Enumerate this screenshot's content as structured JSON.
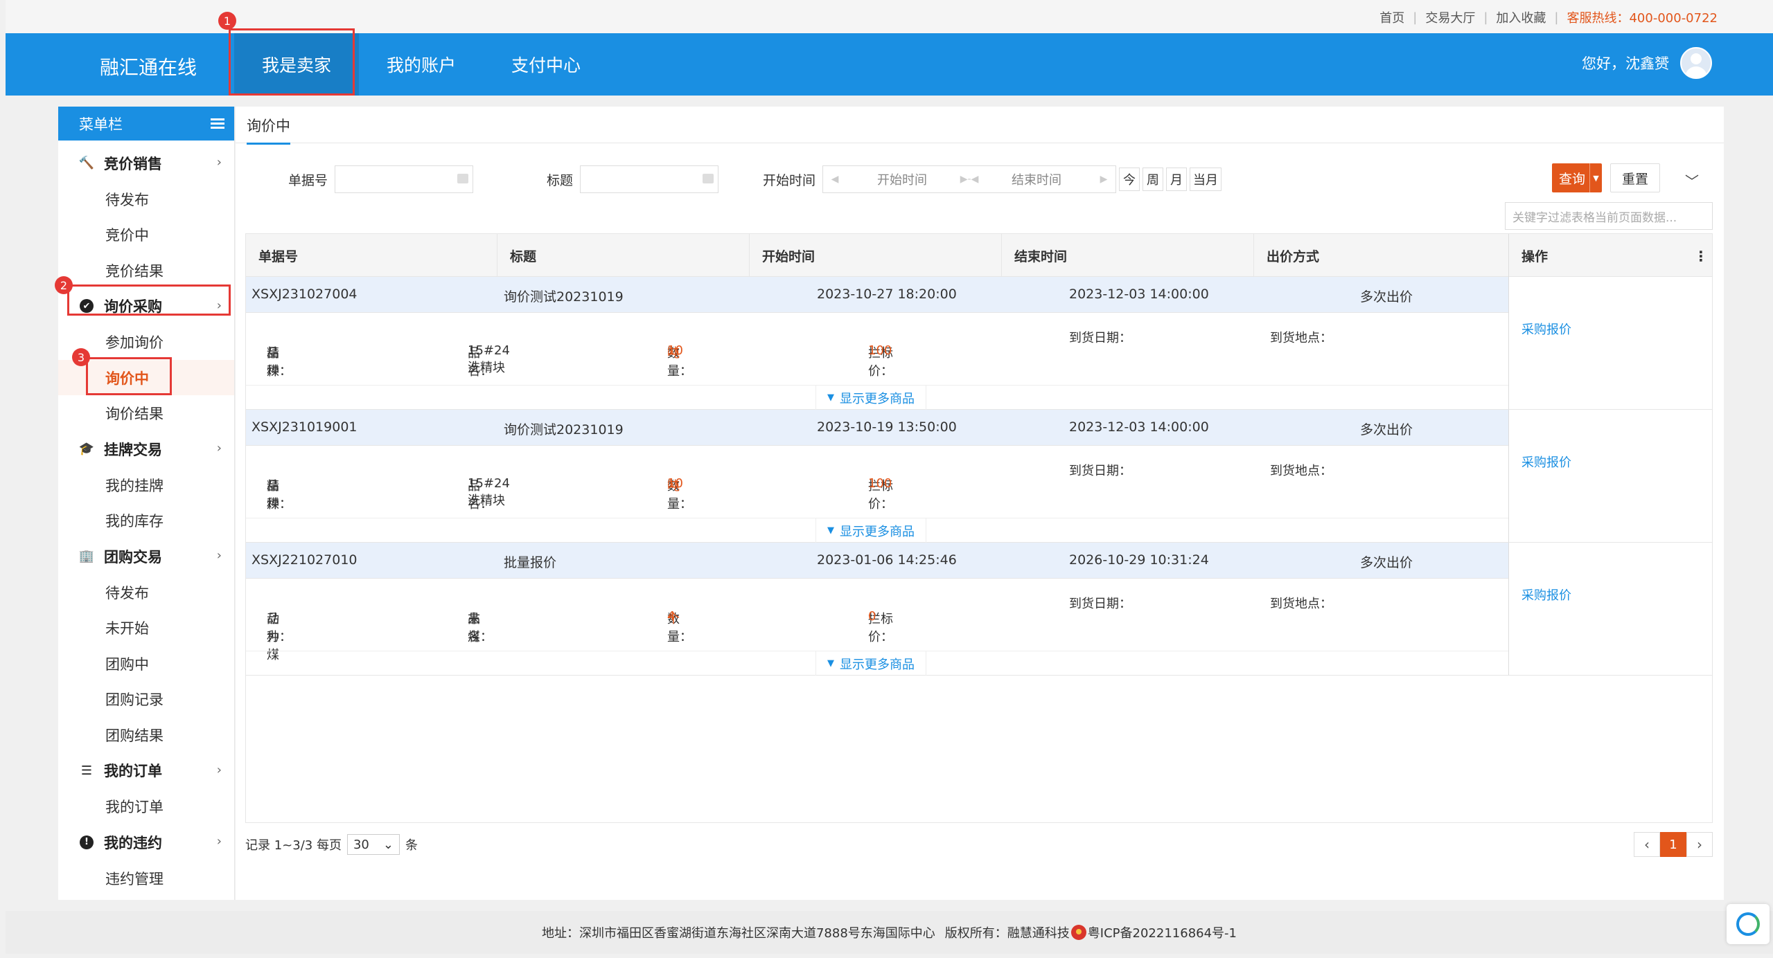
{
  "top_links": {
    "home": "首页",
    "hall": "交易大厅",
    "favorite": "加入收藏",
    "hotline": "客服热线：400-000-0722"
  },
  "header": {
    "brand": "融汇通在线",
    "nav": [
      "我是卖家",
      "我的账户",
      "支付中心"
    ],
    "greeting": "您好，沈鑫赟"
  },
  "sidebar": {
    "title": "菜单栏",
    "groups": [
      {
        "label": "竞价销售",
        "items": [
          "待发布",
          "竞价中",
          "竞价结果"
        ]
      },
      {
        "label": "询价采购",
        "items": [
          "参加询价",
          "询价中",
          "询价结果"
        ]
      },
      {
        "label": "挂牌交易",
        "items": [
          "我的挂牌",
          "我的库存"
        ]
      },
      {
        "label": "团购交易",
        "items": [
          "待发布",
          "未开始",
          "团购中",
          "团购记录",
          "团购结果"
        ]
      },
      {
        "label": "我的订单",
        "items": [
          "我的订单"
        ]
      },
      {
        "label": "我的违约",
        "items": [
          "违约管理"
        ]
      }
    ]
  },
  "tab": {
    "label": "询价中"
  },
  "filters": {
    "doc_no_label": "单据号",
    "title_label": "标题",
    "time_label": "开始时间",
    "start_placeholder": "开始时间",
    "end_placeholder": "结束时间",
    "quick": [
      "今",
      "周",
      "月",
      "当月"
    ],
    "search_label": "查询",
    "reset_label": "重置",
    "keyword_placeholder": "关键字过滤表格当前页面数据..."
  },
  "table": {
    "columns": [
      "单据号",
      "标题",
      "开始时间",
      "结束时间",
      "出价方式"
    ],
    "ops_header": "操作",
    "labels": {
      "variety": "品种：",
      "name": "品名：",
      "qty": "数量：",
      "price": "拦标价：",
      "date": "到货日期：",
      "place": "到货地点："
    },
    "more_label": "显示更多商品",
    "action_label": "采购报价",
    "rows": [
      {
        "no": "XSXJ231027004",
        "title": "询价测试20231019",
        "start": "2023-10-27 18:20:00",
        "end": "2023-12-03 14:00:00",
        "mode": "多次出价",
        "variety": "精煤",
        "name": "15#24洗精块",
        "qty": "10",
        "unit": "吨",
        "price": "100"
      },
      {
        "no": "XSXJ231019001",
        "title": "询价测试20231019",
        "start": "2023-10-19 13:50:00",
        "end": "2023-12-03 14:00:00",
        "mode": "多次出价",
        "variety": "精煤",
        "name": "15#24洗精块",
        "qty": "10",
        "unit": "吨",
        "price": "100"
      },
      {
        "no": "XSXJ221027010",
        "title": "批量报价",
        "start": "2023-01-06 14:25:46",
        "end": "2026-10-29 10:31:24",
        "mode": "多次出价",
        "variety": "动力煤",
        "name": "末煤",
        "qty": "4",
        "unit": "个",
        "price": "0"
      }
    ]
  },
  "pager": {
    "summary": "记录 1~3/3 每页",
    "page_size": "30",
    "unit": "条",
    "current": "1"
  },
  "footer": {
    "address": "地址：深圳市福田区香蜜湖街道东海社区深南大道7888号东海国际中心",
    "copyright": "版权所有：融慧通科技",
    "icp": "粤ICP备2022116864号-1"
  },
  "annotations": [
    "1",
    "2",
    "3"
  ]
}
